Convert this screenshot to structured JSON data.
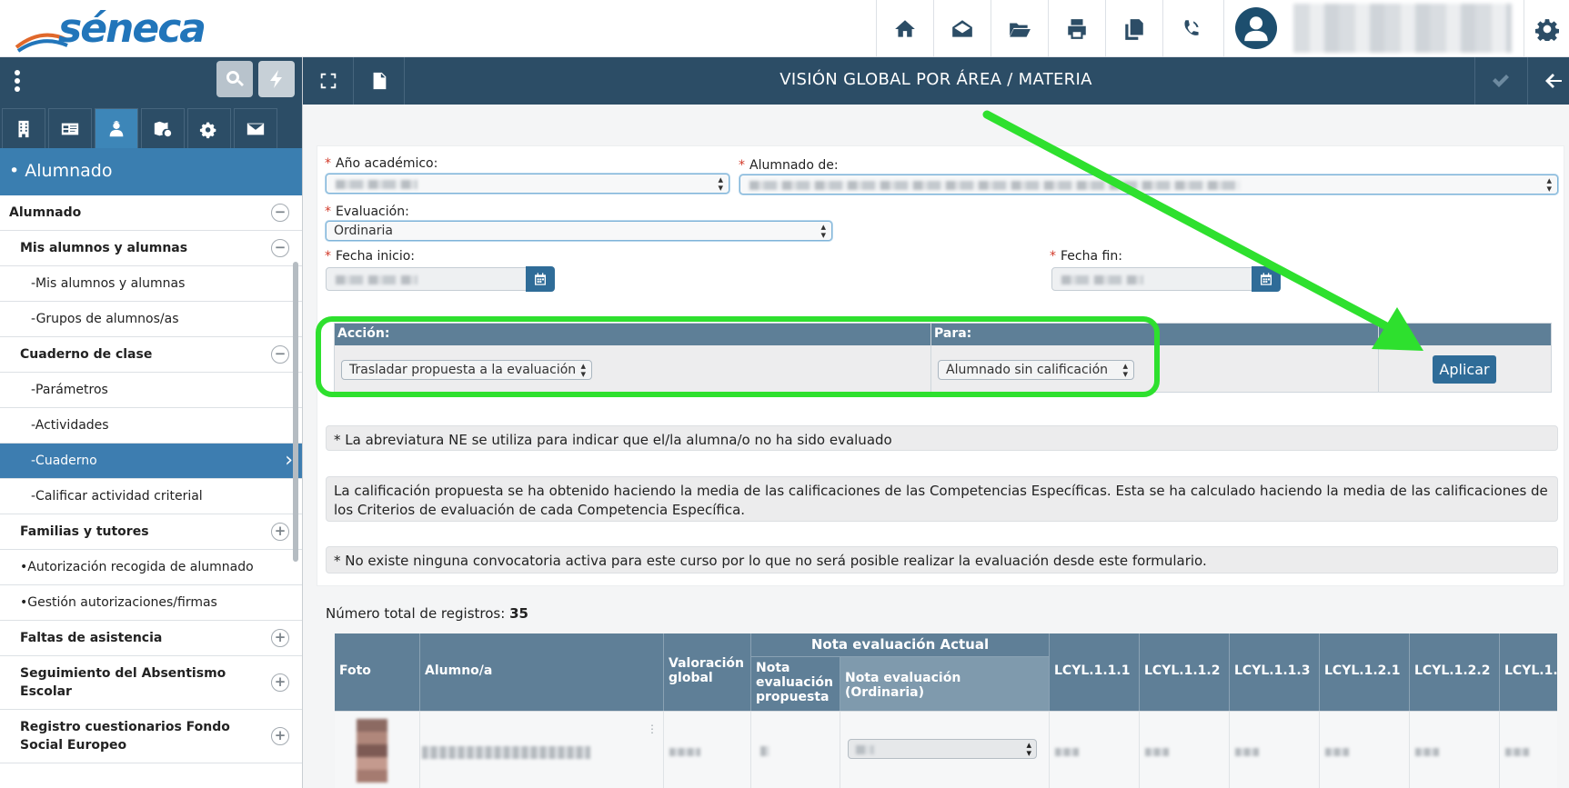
{
  "app": {
    "logo_text": "séneca"
  },
  "header": {
    "icons": [
      "home-icon",
      "envelope-open-icon",
      "folder-open-icon",
      "print-icon",
      "copy-icon",
      "phone-volume-icon"
    ],
    "settings_icon": "gear-icon"
  },
  "sidebar": {
    "section_title": "• Alumnado",
    "items": [
      {
        "label": "Alumnado",
        "level": 0,
        "toggle": "⊖"
      },
      {
        "label": "Mis alumnos y alumnas",
        "level": 1,
        "toggle": "⊖"
      },
      {
        "label": "-Mis alumnos y alumnas",
        "level": 2
      },
      {
        "label": "-Grupos de alumnos/as",
        "level": 2
      },
      {
        "label": "Cuaderno de clase",
        "level": 1,
        "toggle": "⊖"
      },
      {
        "label": "-Parámetros",
        "level": 2
      },
      {
        "label": "-Actividades",
        "level": 2
      },
      {
        "label": "-Cuaderno",
        "level": 2,
        "active": true
      },
      {
        "label": "-Calificar actividad criterial",
        "level": 2
      },
      {
        "label": "Familias y tutores",
        "level": 1,
        "toggle": "+"
      },
      {
        "label": "•Autorización recogida de alumnado",
        "level": 3
      },
      {
        "label": "•Gestión autorizaciones/firmas",
        "level": 3
      },
      {
        "label": "Faltas de asistencia",
        "level": 1,
        "toggle": "+"
      },
      {
        "label": "Seguimiento del Absentismo Escolar",
        "level": 1,
        "toggle": "+"
      },
      {
        "label": "Registro cuestionarios Fondo Social Europeo",
        "level": 1,
        "toggle": "+"
      }
    ]
  },
  "main": {
    "title": "VISIÓN GLOBAL POR ÁREA / MATERIA"
  },
  "form": {
    "anio_label": "Año académico:",
    "alumnado_label": "Alumnado de:",
    "evaluacion_label": "Evaluación:",
    "evaluacion_value": "Ordinaria",
    "fecha_inicio_label": "Fecha inicio:",
    "fecha_fin_label": "Fecha fin:"
  },
  "action": {
    "accion_header": "Acción:",
    "para_header": "Para:",
    "accion_value": "Trasladar propuesta a la evaluación",
    "para_value": "Alumnado sin calificación",
    "apply_label": "Aplicar"
  },
  "notes": {
    "ne_note": "* La abreviatura NE se utiliza para indicar que el/la alumna/o no ha sido evaluado",
    "calc_note": "La calificación propuesta se ha obtenido haciendo la media de las calificaciones de las Competencias Específicas. Esta se ha calculado haciendo la media de las calificaciones de los Criterios de evaluación de cada Competencia Específica.",
    "convocatoria_note": "* No existe ninguna convocatoria activa para este curso por lo que no será posible realizar la evaluación desde este formulario."
  },
  "records": {
    "label": "Número total de registros:",
    "count": "35"
  },
  "table": {
    "col_foto": "Foto",
    "col_alumno": "Alumno/a",
    "col_valoracion": "Valoración global",
    "col_nota_group": "Nota evaluación Actual",
    "col_nota_propuesta": "Nota evaluación propuesta",
    "col_nota_ordinaria": "Nota evaluación (Ordinaria)",
    "competencias": [
      "LCYL.1.1.1",
      "LCYL.1.1.2",
      "LCYL.1.1.3",
      "LCYL.1.2.1",
      "LCYL.1.2.2",
      "LCYL.1."
    ]
  }
}
